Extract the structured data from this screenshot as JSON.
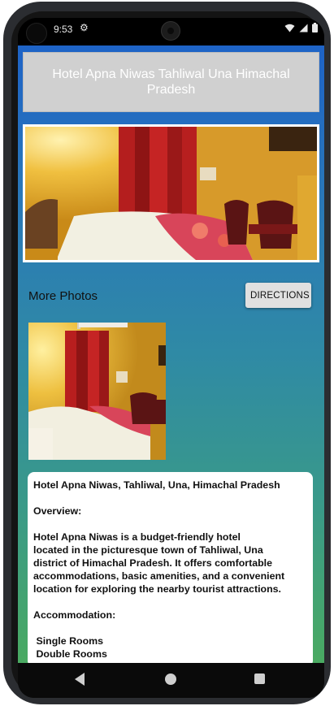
{
  "status_bar": {
    "time": "9:53"
  },
  "hotel": {
    "title": "Hotel Apna Niwas Tahliwal Una Himachal Pradesh"
  },
  "photos": {
    "more_label": "More Photos",
    "directions_label": "DIRECTIONS"
  },
  "description": {
    "lines": [
      "Hotel Apna Niwas, Tahliwal, Una, Himachal Pradesh",
      "",
      "Overview:",
      "",
      "Hotel Apna Niwas is a budget-friendly hotel",
      "located in the picturesque town of Tahliwal, Una",
      "district of Himachal Pradesh. It offers comfortable",
      "accommodations, basic amenities, and a convenient",
      "location for exploring the nearby tourist attractions.",
      "",
      "Accommodation:",
      "",
      " Single Rooms",
      " Double Rooms"
    ]
  },
  "colors": {
    "gradient_top": "#1e63c7",
    "gradient_bottom": "#4aaa62",
    "title_bg": "#d0d0d0",
    "button_bg": "#e0e0e0"
  },
  "icons": [
    "settings-gear-icon",
    "wifi-icon",
    "signal-icon",
    "battery-icon",
    "back-icon",
    "home-icon",
    "recents-icon"
  ]
}
